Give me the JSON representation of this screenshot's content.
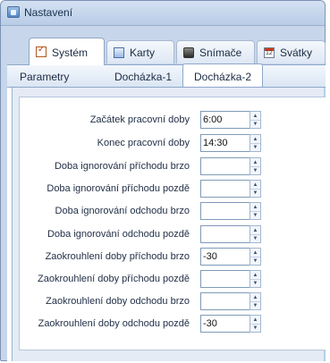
{
  "window": {
    "title": "Nastavení",
    "icon": "app-window-icon"
  },
  "main_tabs": [
    {
      "label": "Systém",
      "icon": "checklist-icon",
      "active": true
    },
    {
      "label": "Karty",
      "icon": "card-icon",
      "active": false
    },
    {
      "label": "Snímače",
      "icon": "reader-icon",
      "active": false
    },
    {
      "label": "Svátky",
      "icon": "calendar-icon",
      "active": false
    }
  ],
  "sub_tabs": [
    {
      "label": "Parametry",
      "active": false
    },
    {
      "label": "Docházka-1",
      "active": false
    },
    {
      "label": "Docházka-2",
      "active": true
    }
  ],
  "fields": [
    {
      "label": "Začátek pracovní doby",
      "value": "6:00"
    },
    {
      "label": "Konec pracovní doby",
      "value": "14:30"
    },
    {
      "label": "Doba ignorování příchodu brzo",
      "value": ""
    },
    {
      "label": "Doba ignorování příchodu pozdě",
      "value": ""
    },
    {
      "label": "Doba ignorování odchodu brzo",
      "value": ""
    },
    {
      "label": "Doba ignorování odchodu pozdě",
      "value": ""
    },
    {
      "label": "Zaokrouhlení doby příchodu brzo",
      "value": "-30"
    },
    {
      "label": "Zaokrouhlení doby příchodu pozdě",
      "value": ""
    },
    {
      "label": "Zaokrouhlení doby odchodu brzo",
      "value": ""
    },
    {
      "label": "Zaokrouhlení doby odchodu pozdě",
      "value": "-30"
    }
  ]
}
